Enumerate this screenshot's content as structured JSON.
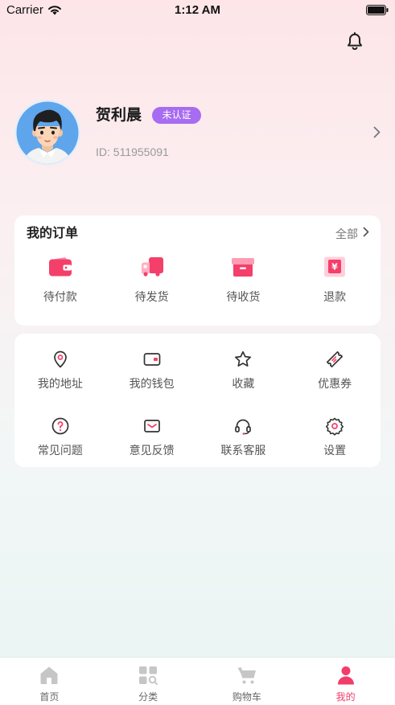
{
  "status_bar": {
    "carrier": "Carrier",
    "time": "1:12 AM",
    "wifi_icon": "wifi-icon",
    "battery_icon": "battery-icon"
  },
  "header": {
    "notification_icon": "bell-icon"
  },
  "profile": {
    "name": "贺利晨",
    "verification_badge": "未认证",
    "user_id": "ID: 511955091",
    "avatar_icon": "avatar",
    "more_icon": "chevron-right-icon"
  },
  "orders": {
    "title": "我的订单",
    "view_all": "全部",
    "view_all_icon": "chevron-right-icon",
    "items": [
      {
        "label": "待付款",
        "icon": "wallet-icon"
      },
      {
        "label": "待发货",
        "icon": "delivery-truck-icon"
      },
      {
        "label": "待收货",
        "icon": "package-box-icon"
      },
      {
        "label": "退款",
        "icon": "refund-icon",
        "symbol": "¥"
      }
    ]
  },
  "services": {
    "items": [
      {
        "label": "我的地址",
        "icon": "location-pin-icon"
      },
      {
        "label": "我的钱包",
        "icon": "wallet-outline-icon"
      },
      {
        "label": "收藏",
        "icon": "star-icon"
      },
      {
        "label": "优惠券",
        "icon": "coupon-icon"
      },
      {
        "label": "常见问题",
        "icon": "question-circle-icon"
      },
      {
        "label": "意见反馈",
        "icon": "envelope-icon"
      },
      {
        "label": "联系客服",
        "icon": "headset-icon"
      },
      {
        "label": "设置",
        "icon": "gear-icon"
      }
    ]
  },
  "tab_bar": {
    "active_index": 3,
    "tabs": [
      {
        "label": "首页",
        "icon": "home-icon"
      },
      {
        "label": "分类",
        "icon": "category-search-icon"
      },
      {
        "label": "购物车",
        "icon": "cart-icon"
      },
      {
        "label": "我的",
        "icon": "person-icon"
      }
    ]
  },
  "colors": {
    "accent": "#f23c6a",
    "badge": "#a76cf1",
    "background_top": "#fde5e8",
    "background_bottom": "#e9f5f3"
  }
}
